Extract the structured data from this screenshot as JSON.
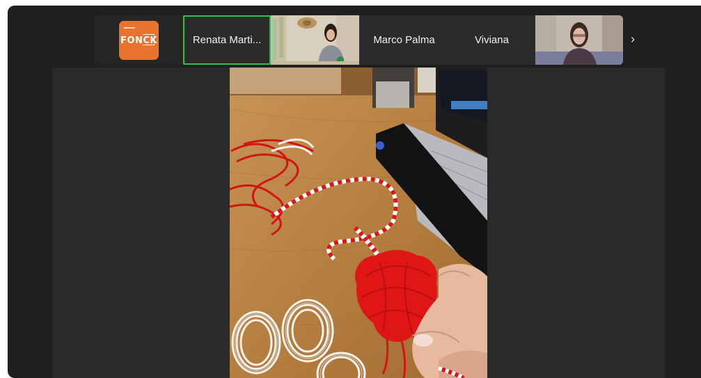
{
  "participants": {
    "logo": {
      "brand_text": "FONCK",
      "tagline": ""
    },
    "renata": {
      "name": "Renata Marti..."
    },
    "marco": {
      "name": "Marco Palma"
    },
    "viviana": {
      "name": "Viviana"
    }
  },
  "strip": {
    "next_icon": "chevron-right-icon",
    "next_glyph": "›"
  },
  "colors": {
    "logo_bg": "#e8732f",
    "active_speaker_border": "#2fbf4e",
    "window_bg": "#1f1f1f",
    "stage_bg": "#2a2a2a"
  }
}
